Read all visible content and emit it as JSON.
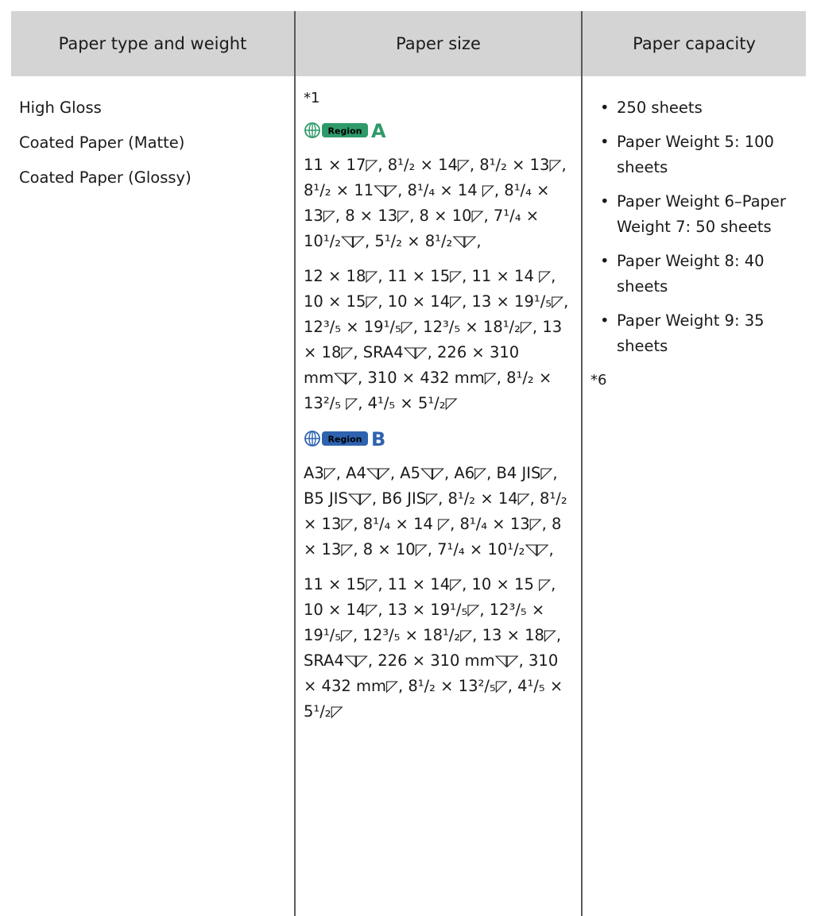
{
  "table": {
    "headers": [
      "Paper type and weight",
      "Paper size",
      "Paper capacity"
    ],
    "paper_types": [
      "High Gloss",
      "Coated Paper (Matte)",
      "Coated Paper (Glossy)"
    ],
    "size_note": "*1",
    "regions": [
      {
        "badge": "Region",
        "letter": "A",
        "color": "#2e9a6a",
        "paragraphs": [
          "11 × 17◸, 8¹/₂ × 14◸, 8¹/₂ × 13◸, 8¹/₂ × 11◹◸, 8¹/₄ × 14 ◸, 8¹/₄ × 13◸, 8 × 13◸, 8 × 10◸, 7¹/₄ × 10¹/₂◹◸, 5¹/₂ × 8¹/₂◹◸,",
          "12 × 18◸, 11 × 15◸, 11 × 14 ◸, 10 × 15◸, 10 × 14◸, 13 × 19¹/₅◸, 12³/₅ × 19¹/₅◸, 12³/₅ × 18¹/₂◸, 13 × 18◸, SRA4◹◸, 226 × 310 mm◹◸, 310 × 432 mm◸, 8¹/₂ × 13²/₅ ◸, 4¹/₅ × 5¹/₂◸"
        ]
      },
      {
        "badge": "Region",
        "letter": "B",
        "color": "#2e63b0",
        "paragraphs": [
          "A3◸, A4◹◸, A5◹◸, A6◸, B4 JIS◸, B5 JIS◹◸, B6 JIS◸, 8¹/₂ × 14◸, 8¹/₂ × 13◸, 8¹/₄ × 14 ◸, 8¹/₄ × 13◸, 8 × 13◸, 8 × 10◸, 7¹/₄ × 10¹/₂◹◸,",
          "11 × 15◸, 11 × 14◸, 10 × 15 ◸, 10 × 14◸, 13 × 19¹/₅◸, 12³/₅ × 19¹/₅◸, 12³/₅ × 18¹/₂◸, 13 × 18◸, SRA4◹◸, 226 × 310 mm◹◸, 310 × 432 mm◸, 8¹/₂ × 13²/₅◸, 4¹/₅ × 5¹/₂◸"
        ]
      }
    ],
    "capacity": [
      "250 sheets",
      "Paper Weight 5: 100 sheets",
      "Paper Weight 6–Paper Weight 7: 50 sheets",
      "Paper Weight 8: 40 sheets",
      "Paper Weight 9: 35 sheets"
    ],
    "capacity_note": "*6"
  }
}
